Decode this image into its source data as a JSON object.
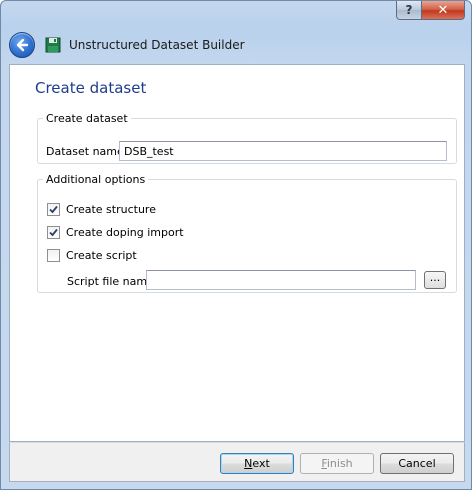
{
  "window": {
    "title": "Unstructured Dataset Builder",
    "help_label": "?",
    "close_label": "✕"
  },
  "page": {
    "title": "Create dataset"
  },
  "create_group": {
    "legend": "Create dataset",
    "dataset_name_label": "Dataset name",
    "dataset_name_value": "DSB_test"
  },
  "options_group": {
    "legend": "Additional options",
    "create_structure": {
      "label": "Create structure",
      "checked": true
    },
    "create_doping_import": {
      "label": "Create doping import",
      "checked": true
    },
    "create_script": {
      "label": "Create script",
      "checked": false
    },
    "script_file_label": "Script file name",
    "script_file_value": "",
    "browse_label": "..."
  },
  "footer": {
    "next_label": "Next",
    "finish_label": "Finish",
    "cancel_label": "Cancel"
  },
  "colors": {
    "accent_title": "#1e3d8c",
    "frame": "#c4d7ee"
  }
}
